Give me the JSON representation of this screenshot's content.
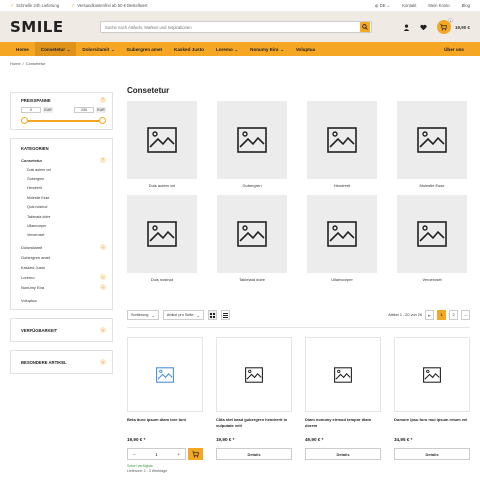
{
  "topbar": {
    "usps": [
      "Schnelle 24h Lieferung",
      "Versandkostenfrei ab 50 € Bestellwert"
    ],
    "language": "DE",
    "contact": "Kontakt",
    "account": "Mein Konto",
    "blog": "Blog"
  },
  "header": {
    "logo": "SMILE",
    "search_placeholder": "Suche nach Artikeln, Marken und Inspirationen",
    "cart_count": "1",
    "cart_total": "19,90 €"
  },
  "nav": {
    "items": [
      {
        "label": "Home",
        "has_dropdown": false
      },
      {
        "label": "Consetetur",
        "has_dropdown": true,
        "active": true
      },
      {
        "label": "Dolorsitamit",
        "has_dropdown": true
      },
      {
        "label": "Gubergren amet",
        "has_dropdown": false
      },
      {
        "label": "Kasked Justo",
        "has_dropdown": false
      },
      {
        "label": "Loremo",
        "has_dropdown": true
      },
      {
        "label": "Nonumy Eira",
        "has_dropdown": true
      },
      {
        "label": "Voluptua",
        "has_dropdown": false
      }
    ],
    "about": "Über uns"
  },
  "breadcrumb": {
    "home": "Home",
    "current": "Consetetur"
  },
  "filters": {
    "price": {
      "title": "PREISSPANNE",
      "min": "0",
      "max": "230",
      "currency": "EUR"
    },
    "categories": {
      "title": "KATEGORIEN",
      "items": [
        {
          "label": "Consetetur",
          "active": true,
          "toggle": "up"
        },
        {
          "label": "Duis autem vel",
          "sub": true
        },
        {
          "label": "Gubergren",
          "sub": true
        },
        {
          "label": "Hendrerit",
          "sub": true
        },
        {
          "label": "Molestie Esse",
          "sub": true
        },
        {
          "label": "Quis nostrud",
          "sub": true
        },
        {
          "label": "Takimata dolre",
          "sub": true
        },
        {
          "label": "Ullamcorper",
          "sub": true
        },
        {
          "label": "Veroeroset",
          "sub": true
        },
        {
          "label": "Dolorsitamit",
          "toggle": "down"
        },
        {
          "label": "Gubergren amet"
        },
        {
          "label": "Kasked Justo"
        },
        {
          "label": "Loremo",
          "toggle": "down"
        },
        {
          "label": "Nonumy Eira",
          "toggle": "down"
        },
        {
          "label": "Voluptua"
        }
      ]
    },
    "availability": {
      "title": "VERFÜGBARKEIT"
    },
    "special": {
      "title": "BESONDERE ARTIKEL"
    }
  },
  "main": {
    "title": "Consetetur",
    "subcategories": [
      "Duis autem vel",
      "Gubergren",
      "Hendrerit",
      "Molestie Esse",
      "Duis nostrud",
      "Takimata dolre",
      "Ullamcorper",
      "Veroeroset"
    ]
  },
  "toolbar": {
    "sort_label": "Sortierung",
    "per_page_label": "Artikel pro Seite",
    "range": "Artikel 1 - 20 von 26",
    "pages": [
      "1",
      "2"
    ],
    "current_page": "1"
  },
  "products": [
    {
      "name": "Beta duro ipsum diam lore tuni",
      "price": "19,90 € *",
      "action": "cart",
      "qty": "1",
      "availability": "Sofort verfügbar",
      "delivery": "Lieferzeit: 2 - 3 Werktage"
    },
    {
      "name": "Clita stet kasd gubergren hendrerit in vulputate velt",
      "price": "19,90 € *",
      "action": "Details"
    },
    {
      "name": "Diam nonumy eirmod tempor diam dorem",
      "price": "49,90 € *",
      "action": "Details"
    },
    {
      "name": "Domore ipsu furo mui ipsum retum vel",
      "price": "34,95 € *",
      "action": "Details"
    }
  ],
  "colors": {
    "accent": "#f5a623",
    "header_bg": "#efebe4",
    "tile_bg": "#ececec"
  }
}
